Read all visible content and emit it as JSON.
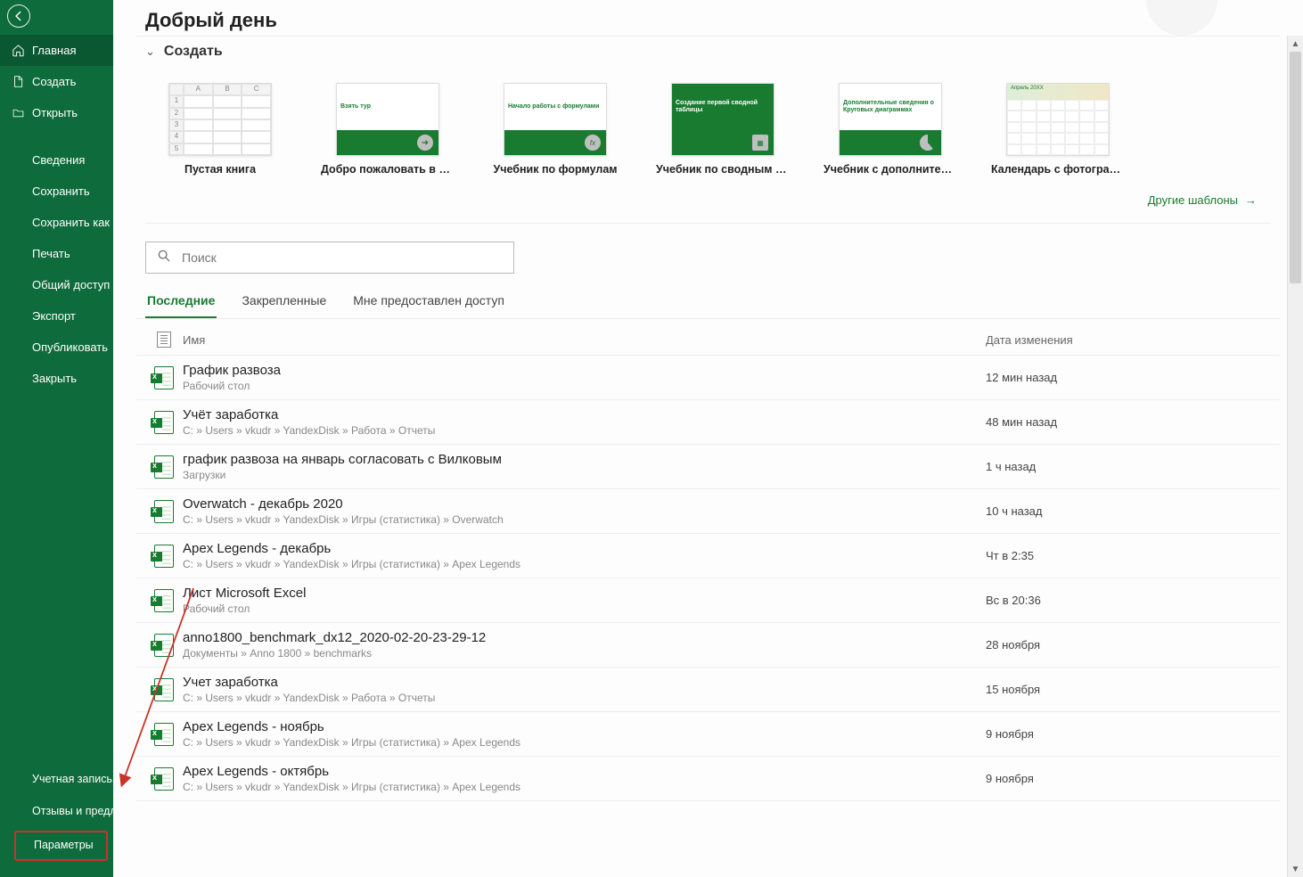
{
  "header": {
    "greeting": "Добрый день"
  },
  "sidebar": {
    "primary": [
      {
        "icon": "home-icon",
        "label": "Главная",
        "active": true
      },
      {
        "icon": "new-icon",
        "label": "Создать",
        "active": false
      },
      {
        "icon": "open-icon",
        "label": "Открыть",
        "active": false
      }
    ],
    "secondary": [
      {
        "label": "Сведения"
      },
      {
        "label": "Сохранить"
      },
      {
        "label": "Сохранить как"
      },
      {
        "label": "Печать"
      },
      {
        "label": "Общий доступ"
      },
      {
        "label": "Экспорт"
      },
      {
        "label": "Опубликовать"
      },
      {
        "label": "Закрыть"
      }
    ],
    "bottom": {
      "account": "Учетная запись",
      "feedback": "Отзывы и предложения",
      "options": "Параметры"
    }
  },
  "create": {
    "title": "Создать",
    "templates": [
      {
        "name": "Пустая книга",
        "kind": "blank"
      },
      {
        "name": "Добро пожаловать в Excel",
        "kind": "tour",
        "thumb_text": "Взять тур"
      },
      {
        "name": "Учебник по формулам",
        "kind": "formula",
        "thumb_text": "Начало работы с формулами"
      },
      {
        "name": "Учебник по сводным таб…",
        "kind": "pivot",
        "thumb_text": "Создание первой сводной таблицы"
      },
      {
        "name": "Учебник с дополнительн…",
        "kind": "pie",
        "thumb_text": "Дополнительные сведения о Круговых диаграммах"
      },
      {
        "name": "Календарь с фотография…",
        "kind": "calendar",
        "thumb_text": "Апрель 20XX"
      }
    ],
    "more_label": "Другие шаблоны"
  },
  "search": {
    "placeholder": "Поиск"
  },
  "tabs": [
    {
      "label": "Последние",
      "active": true
    },
    {
      "label": "Закрепленные",
      "active": false
    },
    {
      "label": "Мне предоставлен доступ",
      "active": false
    }
  ],
  "columns": {
    "name": "Имя",
    "date": "Дата изменения"
  },
  "recent": [
    {
      "name": "График развоза",
      "path": "Рабочий стол",
      "date": "12 мин назад"
    },
    {
      "name": "Учёт заработка",
      "path": "C: » Users » vkudr » YandexDisk » Работа » Отчеты",
      "date": "48 мин назад"
    },
    {
      "name": "график развоза на январь согласовать с Вилковым",
      "path": "Загрузки",
      "date": "1 ч назад"
    },
    {
      "name": "Overwatch - декабрь 2020",
      "path": "C: » Users » vkudr » YandexDisk » Игры (статистика) » Overwatch",
      "date": "10 ч назад"
    },
    {
      "name": "Apex Legends - декабрь",
      "path": "C: » Users » vkudr » YandexDisk » Игры (статистика) » Apex Legends",
      "date": "Чт в 2:35"
    },
    {
      "name": "Лист Microsoft Excel",
      "path": "Рабочий стол",
      "date": "Вс в 20:36"
    },
    {
      "name": "anno1800_benchmark_dx12_2020-02-20-23-29-12",
      "path": "Документы » Anno 1800 » benchmarks",
      "date": "28 ноября"
    },
    {
      "name": "Учет заработка",
      "path": "C: » Users » vkudr » YandexDisk » Работа » Отчеты",
      "date": "15 ноября"
    },
    {
      "name": "Apex Legends - ноябрь",
      "path": "C: » Users » vkudr » YandexDisk » Игры (статистика) » Apex Legends",
      "date": "9 ноября"
    },
    {
      "name": "Apex Legends - октябрь",
      "path": "C: » Users » vkudr » YandexDisk » Игры (статистика) » Apex Legends",
      "date": "9 ноября"
    }
  ]
}
